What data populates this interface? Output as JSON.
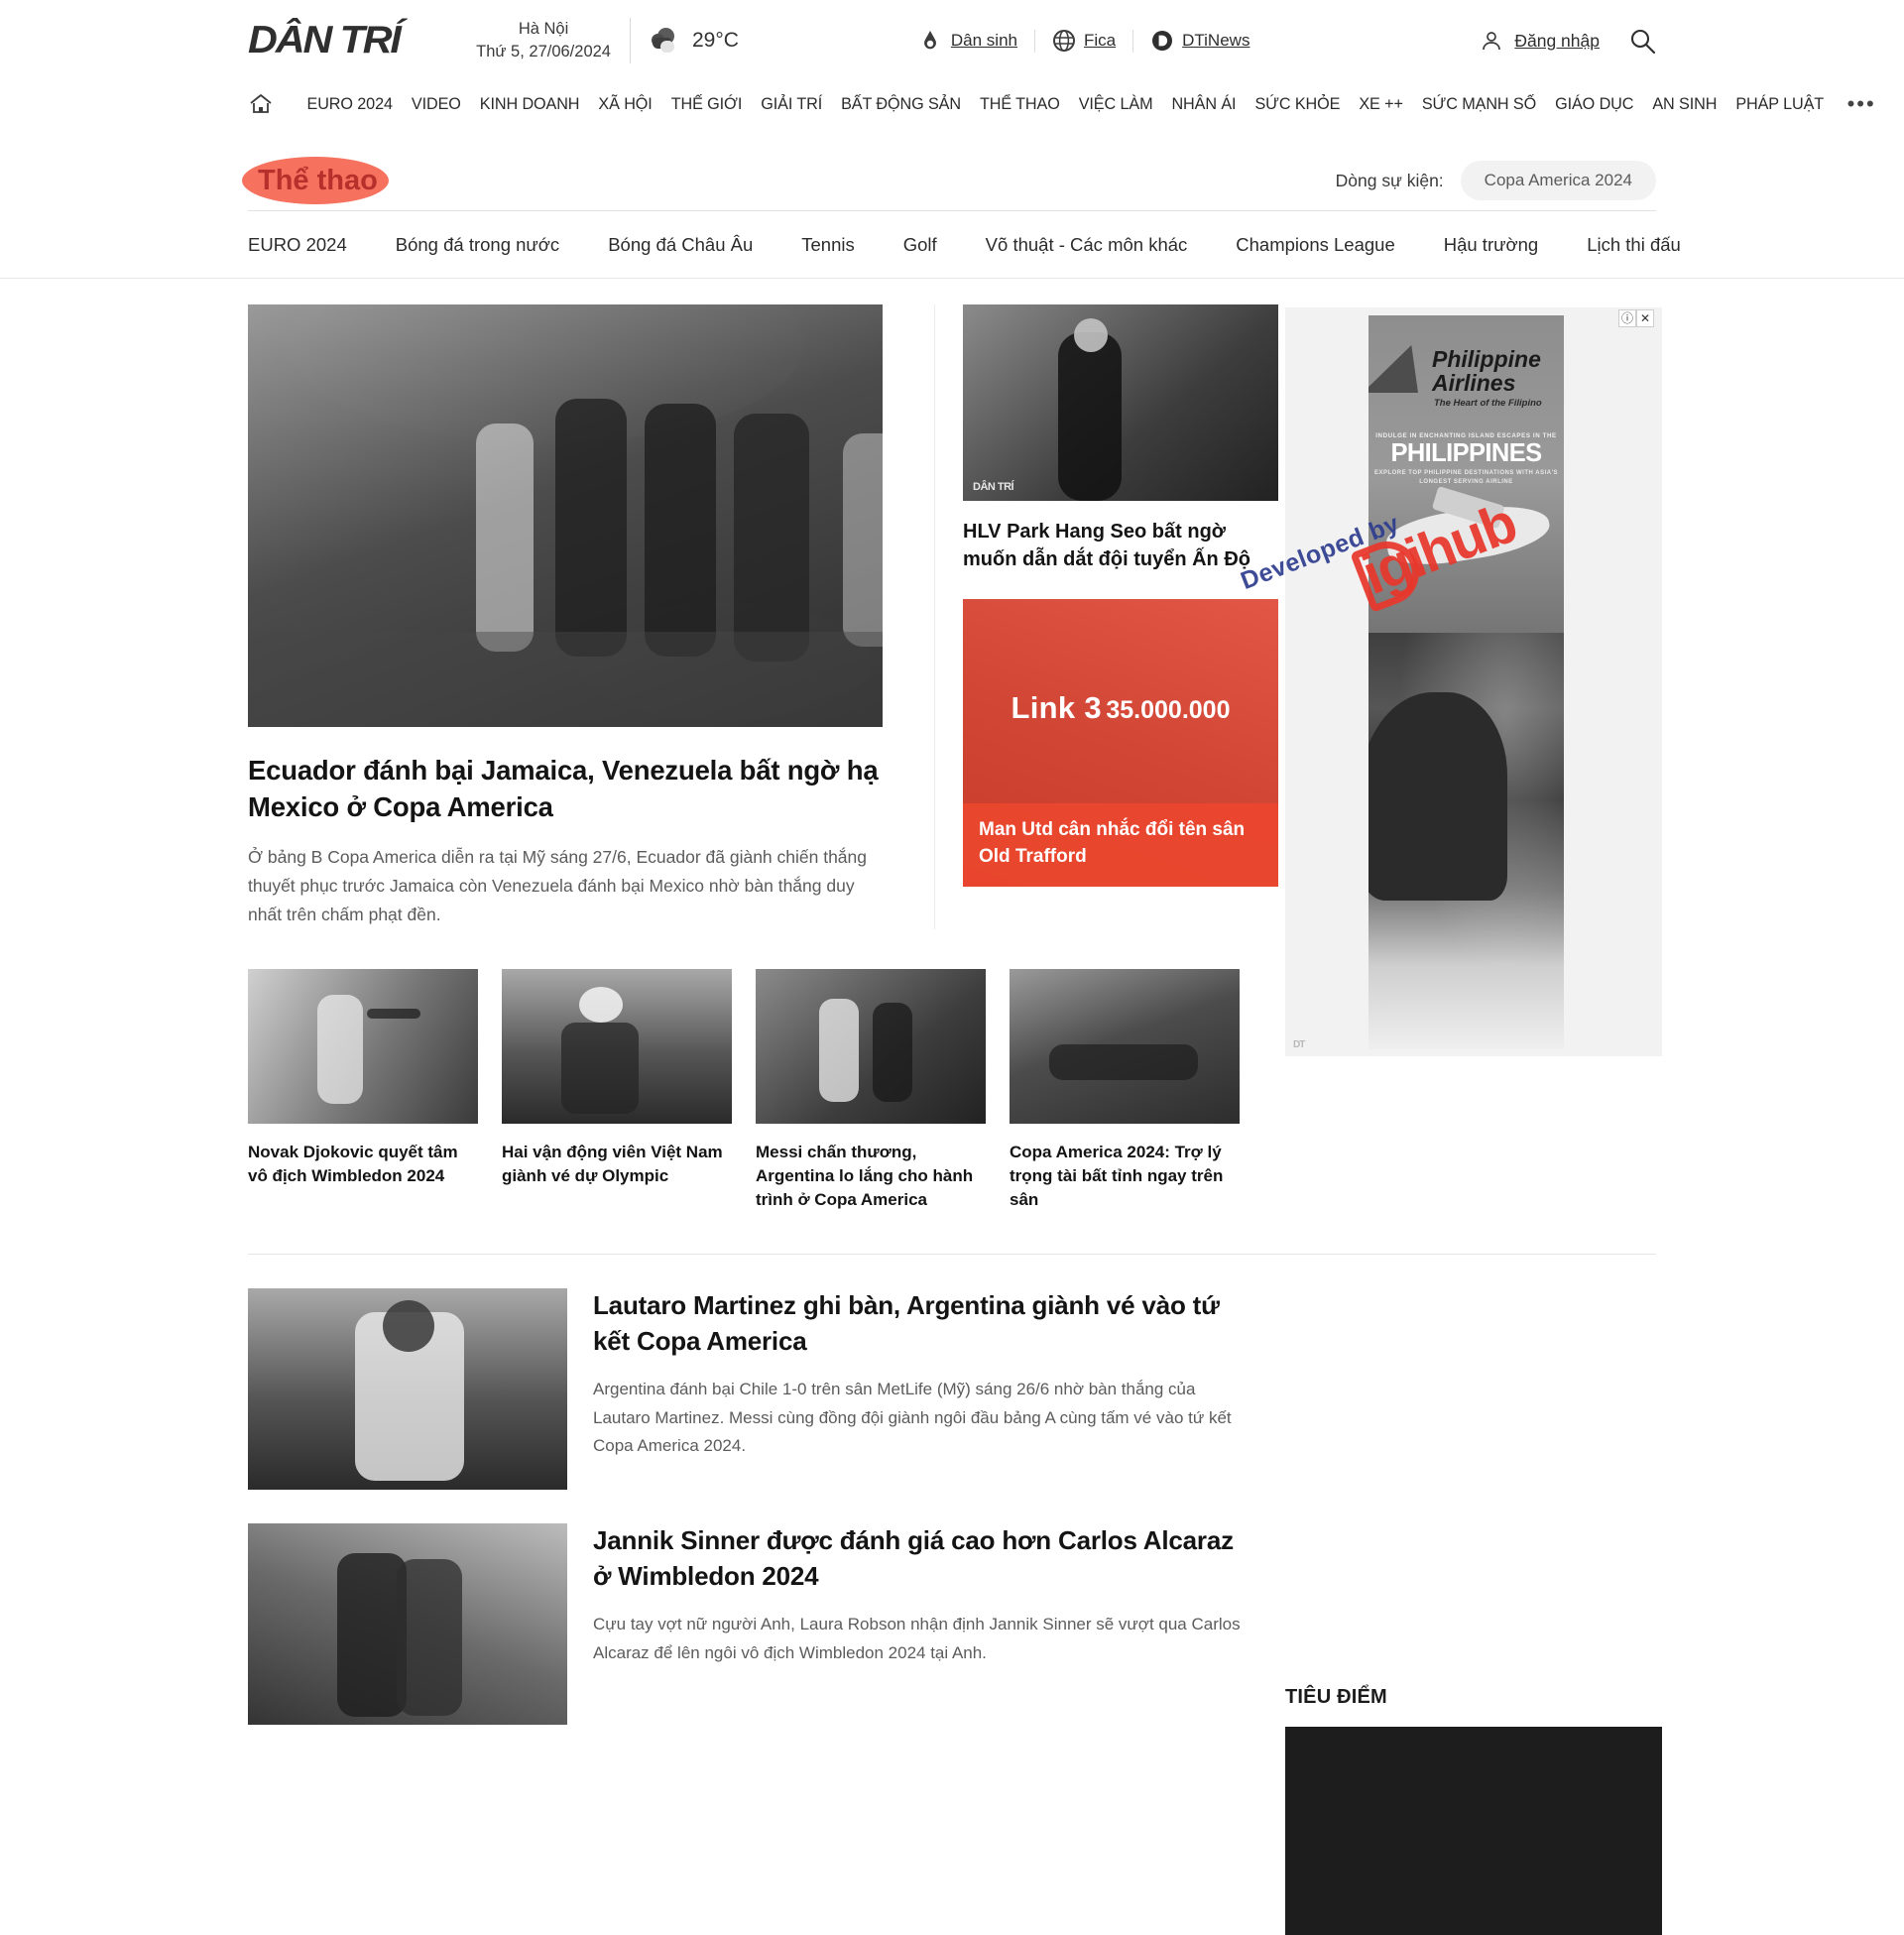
{
  "header": {
    "logo": "DÂN TRÍ",
    "weather": {
      "city": "Hà Nội",
      "date": "Thứ 5, 27/06/2024",
      "temp": "29°C",
      "icon": "cloud-icon"
    },
    "brand_links": [
      {
        "label": "Dân sinh",
        "icon": "pen-drop-icon"
      },
      {
        "label": "Fica",
        "icon": "globe-icon"
      },
      {
        "label": "DTiNews",
        "icon": "dtinews-circle-icon"
      }
    ],
    "login_label": "Đăng nhập",
    "login_icon": "user-icon",
    "search_icon": "search-icon"
  },
  "mainnav": {
    "home_icon": "home-icon",
    "items": [
      "EURO 2024",
      "VIDEO",
      "KINH DOANH",
      "XÃ HỘI",
      "THẾ GIỚI",
      "GIẢI TRÍ",
      "BẤT ĐỘNG SẢN",
      "THỂ THAO",
      "VIỆC LÀM",
      "NHÂN ÁI",
      "SỨC KHỎE",
      "XE ++",
      "SỨC MẠNH SỐ",
      "GIÁO DỤC",
      "AN SINH",
      "PHÁP LUẬT"
    ],
    "more": "•••"
  },
  "section": {
    "title": "Thể thao",
    "highlight_color": "#f4533c",
    "title_color": "#b7312c",
    "event_label": "Dòng sự kiện:",
    "event_chip": "Copa America 2024"
  },
  "subnav": {
    "items": [
      "EURO 2024",
      "Bóng đá trong nước",
      "Bóng đá Châu Âu",
      "Tennis",
      "Golf",
      "Võ thuật - Các môn khác",
      "Champions League",
      "Hậu trường",
      "Lịch thi đấu"
    ]
  },
  "hero": {
    "image_alt": "ecuador-jamaica-match-photo",
    "title": "Ecuador đánh bại Jamaica, Venezuela bất ngờ hạ Mexico ở Copa America",
    "sapo": "Ở bảng B Copa America diễn ra tại Mỹ sáng 27/6, Ecuador đã giành chiến thắng thuyết phục trước Jamaica còn Venezuela đánh bại Mexico nhờ bàn thắng duy nhất trên chấm phạt đền."
  },
  "side": {
    "article": {
      "image_alt": "park-hang-seo-photo",
      "watermark": "DÂN TRÍ",
      "title": "HLV Park Hang Seo bất ngờ muốn dẫn dắt đội tuyển Ấn Độ"
    },
    "promo": {
      "link_label": "Link 3",
      "amount": "35.000.000",
      "caption": "Man Utd cân nhắc đổi tên sân Old Trafford",
      "color": "#f0402a"
    }
  },
  "cards": [
    {
      "image_alt": "djokovic-photo",
      "title": "Novak Djokovic quyết tâm vô địch Wimbledon 2024"
    },
    {
      "image_alt": "vietnam-archers-photo",
      "title": "Hai vận động viên Việt Nam giành vé dự Olympic"
    },
    {
      "image_alt": "messi-photo",
      "title": "Messi chấn thương, Argentina lo lắng cho hành trình ở Copa America"
    },
    {
      "image_alt": "referee-collapse-photo",
      "title": "Copa America 2024: Trợ lý trọng tài bất tỉnh ngay trên sân"
    }
  ],
  "lower_articles": [
    {
      "image_alt": "lautaro-martinez-photo",
      "title": "Lautaro Martinez ghi bàn, Argentina giành vé vào tứ kết Copa America",
      "sapo": "Argentina đánh bại Chile 1-0 trên sân MetLife (Mỹ) sáng 26/6 nhờ bàn thắng của Lautaro Martinez. Messi cùng đồng đội giành ngôi đầu bảng A cùng tấm vé vào tứ kết Copa America 2024."
    },
    {
      "image_alt": "sinner-alcaraz-photo",
      "title": "Jannik Sinner được đánh giá cao hơn Carlos Alcaraz ở Wimbledon 2024",
      "sapo": "Cựu tay vợt nữ người Anh, Laura Robson nhận định Jannik Sinner sẽ vượt qua Carlos Alcaraz để lên ngôi vô địch Wimbledon 2024 tại Anh."
    }
  ],
  "ad": {
    "brand_line1": "Philippine",
    "brand_line2": "Airlines",
    "tagline": "The Heart of the Filipino",
    "kicker": "INDULGE IN ENCHANTING ISLAND ESCAPES IN THE",
    "headline": "PHILIPPINES",
    "subline": "EXPLORE TOP PHILIPPINE DESTINATIONS WITH ASIA'S LONGEST SERVING AIRLINE",
    "info_icon": "ad-info-icon",
    "close_icon": "ad-close-icon",
    "footer_mark": "DT"
  },
  "watermark": {
    "line1": "Developed by",
    "line2": "igihub",
    "line1_color": "#2e3d8f",
    "line2_color": "#e8372b"
  },
  "tieudiem": {
    "title": "TIÊU ĐIỂM",
    "image_alt": "featured-photo"
  }
}
